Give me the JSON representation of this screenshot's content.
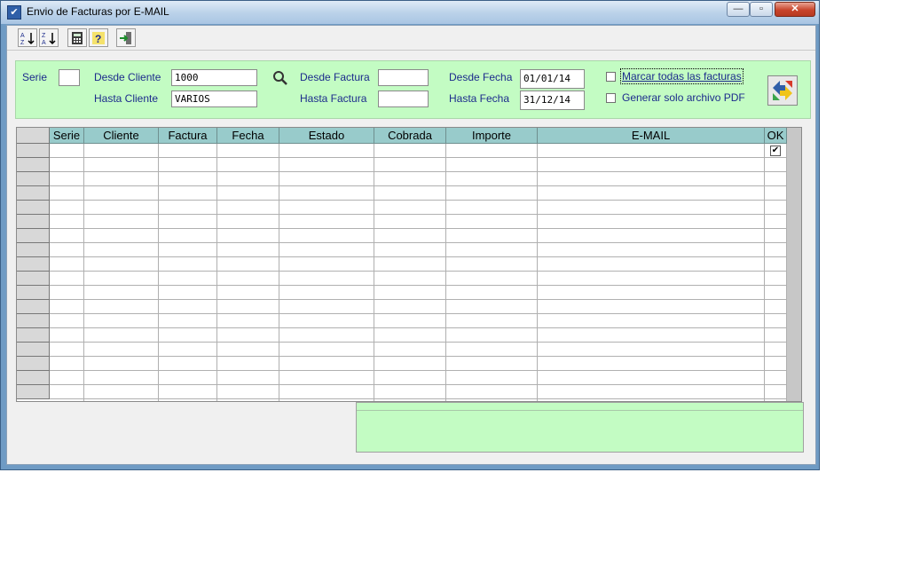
{
  "window": {
    "title": "Envio de Facturas por E-MAIL",
    "close_glyph": "✕",
    "min_glyph": "—",
    "max_glyph": "▫"
  },
  "toolbar": {
    "buttons": [
      {
        "name": "sort-ascending-icon"
      },
      {
        "name": "sort-descending-icon"
      },
      {
        "name": "calculator-icon"
      },
      {
        "name": "help-icon"
      },
      {
        "name": "exit-icon"
      }
    ]
  },
  "filters": {
    "serie_label": "Serie",
    "serie_value": "",
    "desde_cliente_label": "Desde Cliente",
    "desde_cliente_value": "1000",
    "hasta_cliente_label": "Hasta Cliente",
    "hasta_cliente_value": "VARIOS",
    "desde_factura_label": "Desde Factura",
    "desde_factura_value": "",
    "hasta_factura_label": "Hasta Factura",
    "hasta_factura_value": "",
    "desde_fecha_label": "Desde Fecha",
    "desde_fecha_value": "01/01/14",
    "hasta_fecha_label": "Hasta Fecha",
    "hasta_fecha_value": "31/12/14",
    "marcar_todas_label": "Marcar todas las facturas",
    "marcar_todas_checked": false,
    "generar_pdf_label": "Generar solo archivo PDF",
    "generar_pdf_checked": false
  },
  "grid": {
    "columns": [
      "Serie",
      "Cliente",
      "Factura",
      "Fecha",
      "Estado",
      "Cobrada",
      "Importe",
      "E-MAIL",
      "OK"
    ],
    "rows": [],
    "first_row_ok_checked": true,
    "ok_check_glyph": "✔"
  },
  "colors": {
    "filter_panel": "#c3fcc3",
    "grid_header": "#98cbcb",
    "label_text": "#1c2b8c"
  }
}
